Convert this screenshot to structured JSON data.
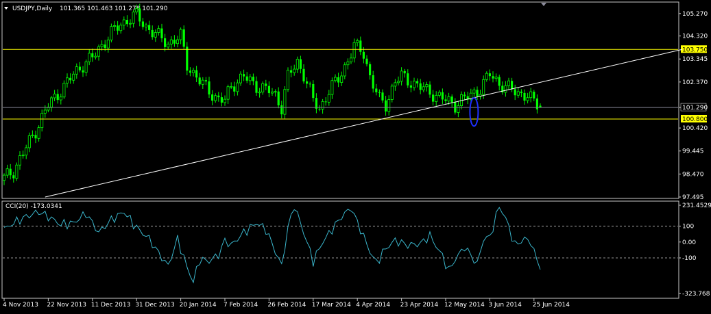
{
  "colors": {
    "background": "#000000",
    "frame": "#c8c8c8",
    "candle": "#00ff00",
    "level_line": "#ffff00",
    "level_label_bg": "#ffff00",
    "current_price_line": "#7f7f8f",
    "trendline": "#ffffff",
    "highlight_ellipse": "#1e2fff",
    "cci_line": "#3ab6cc",
    "cci_level": "#c8c8c8",
    "text": "#ffffff"
  },
  "header": {
    "arrow_icon": "triangle-down-icon",
    "symbol": "USDJPY,Daily",
    "ohlc": "101.365 101.463 101.278 101.290"
  },
  "chart_data": [
    {
      "type": "candlestick",
      "title": "USDJPY,Daily",
      "ylim": [
        97.495,
        105.7
      ],
      "y_ticks": [
        "105.270",
        "104.320",
        "103.345",
        "102.370",
        "101.290",
        "100.420",
        "99.445",
        "98.470",
        "97.495"
      ],
      "y_tick_values": [
        105.27,
        104.32,
        103.345,
        102.37,
        101.29,
        100.42,
        99.445,
        98.47,
        97.495
      ],
      "x_ticks": [
        "4 Nov 2013",
        "22 Nov 2013",
        "11 Dec 2013",
        "31 Dec 2013",
        "20 Jan 2014",
        "7 Feb 2014",
        "26 Feb 2014",
        "17 Mar 2014",
        "4 Apr 2014",
        "23 Apr 2014",
        "12 May 2014",
        "3 Jun 2014",
        "25 Jun 2014"
      ],
      "x_tick_bar_index": [
        0,
        14,
        28,
        42,
        56,
        70,
        84,
        98,
        112,
        126,
        140,
        154,
        168
      ],
      "close_path": {
        "bar_count": 171,
        "anchors": [
          [
            0,
            98.3
          ],
          [
            3,
            98.6
          ],
          [
            7,
            99.6
          ],
          [
            10,
            100.3
          ],
          [
            14,
            101.4
          ],
          [
            18,
            102.0
          ],
          [
            22,
            102.7
          ],
          [
            25,
            103.1
          ],
          [
            28,
            103.4
          ],
          [
            32,
            104.1
          ],
          [
            35,
            104.6
          ],
          [
            39,
            105.0
          ],
          [
            42,
            105.2
          ],
          [
            45,
            104.7
          ],
          [
            48,
            104.4
          ],
          [
            52,
            104.0
          ],
          [
            56,
            104.3
          ],
          [
            58,
            103.1
          ],
          [
            62,
            102.4
          ],
          [
            65,
            102.0
          ],
          [
            68,
            101.6
          ],
          [
            70,
            101.6
          ],
          [
            72,
            102.2
          ],
          [
            76,
            102.6
          ],
          [
            80,
            102.2
          ],
          [
            84,
            102.0
          ],
          [
            86,
            101.8
          ],
          [
            88,
            101.3
          ],
          [
            90,
            102.6
          ],
          [
            93,
            103.2
          ],
          [
            95,
            102.7
          ],
          [
            98,
            101.6
          ],
          [
            100,
            101.2
          ],
          [
            103,
            102.0
          ],
          [
            106,
            102.5
          ],
          [
            108,
            103.0
          ],
          [
            111,
            103.9
          ],
          [
            114,
            103.6
          ],
          [
            116,
            102.6
          ],
          [
            119,
            101.6
          ],
          [
            121,
            101.4
          ],
          [
            124,
            102.4
          ],
          [
            126,
            102.6
          ],
          [
            130,
            102.3
          ],
          [
            134,
            102.0
          ],
          [
            137,
            101.8
          ],
          [
            140,
            101.6
          ],
          [
            143,
            101.4
          ],
          [
            145,
            101.6
          ],
          [
            148,
            101.8
          ],
          [
            151,
            102.1
          ],
          [
            154,
            102.7
          ],
          [
            157,
            102.3
          ],
          [
            160,
            102.1
          ],
          [
            163,
            101.9
          ],
          [
            166,
            101.8
          ],
          [
            168,
            101.5
          ],
          [
            170,
            101.29
          ]
        ]
      },
      "last_ohlc": {
        "open": 101.365,
        "high": 101.463,
        "low": 101.278,
        "close": 101.29
      },
      "current_price": 101.29,
      "horizontal_levels": [
        {
          "label": "103.750",
          "value": 103.75
        },
        {
          "label": "100.800",
          "value": 100.8
        }
      ],
      "trendline": {
        "from": [
          13,
          97.495
        ],
        "to": [
          215,
          103.75
        ]
      },
      "highlight_ellipse": {
        "bar": 149,
        "center": 101.1,
        "half_height": 0.6
      }
    },
    {
      "type": "line",
      "title": "CCI(20) -173.0341",
      "ylim": [
        -323.768,
        231.4529
      ],
      "y_ticks": [
        "231.4529",
        "100",
        "0.00",
        "-100",
        "-323.768"
      ],
      "y_tick_values": [
        231.4529,
        100,
        0,
        -100,
        -323.768
      ],
      "levels": [
        100,
        -100
      ],
      "series": [
        {
          "bar_count": 171,
          "anchors": [
            [
              0,
              80
            ],
            [
              3,
              120
            ],
            [
              7,
              160
            ],
            [
              11,
              190
            ],
            [
              14,
              160
            ],
            [
              18,
              110
            ],
            [
              22,
              120
            ],
            [
              26,
              180
            ],
            [
              30,
              60
            ],
            [
              34,
              140
            ],
            [
              38,
              190
            ],
            [
              42,
              90
            ],
            [
              46,
              20
            ],
            [
              49,
              -70
            ],
            [
              52,
              -150
            ],
            [
              55,
              20
            ],
            [
              58,
              -160
            ],
            [
              60,
              -250
            ],
            [
              62,
              -110
            ],
            [
              65,
              -120
            ],
            [
              68,
              -80
            ],
            [
              70,
              10
            ],
            [
              72,
              -20
            ],
            [
              76,
              60
            ],
            [
              80,
              120
            ],
            [
              83,
              80
            ],
            [
              86,
              -60
            ],
            [
              88,
              -150
            ],
            [
              90,
              90
            ],
            [
              92,
              230
            ],
            [
              95,
              60
            ],
            [
              98,
              -120
            ],
            [
              101,
              0
            ],
            [
              104,
              80
            ],
            [
              107,
              160
            ],
            [
              110,
              215
            ],
            [
              113,
              80
            ],
            [
              116,
              -60
            ],
            [
              118,
              -130
            ],
            [
              121,
              -40
            ],
            [
              124,
              10
            ],
            [
              128,
              -20
            ],
            [
              132,
              -10
            ],
            [
              135,
              40
            ],
            [
              139,
              -90
            ],
            [
              141,
              -180
            ],
            [
              143,
              -110
            ],
            [
              146,
              -30
            ],
            [
              150,
              -140
            ],
            [
              152,
              20
            ],
            [
              154,
              30
            ],
            [
              157,
              225
            ],
            [
              159,
              150
            ],
            [
              162,
              -20
            ],
            [
              165,
              20
            ],
            [
              167,
              0
            ],
            [
              169,
              -120
            ],
            [
              170,
              -173.0341
            ]
          ]
        }
      ]
    }
  ]
}
